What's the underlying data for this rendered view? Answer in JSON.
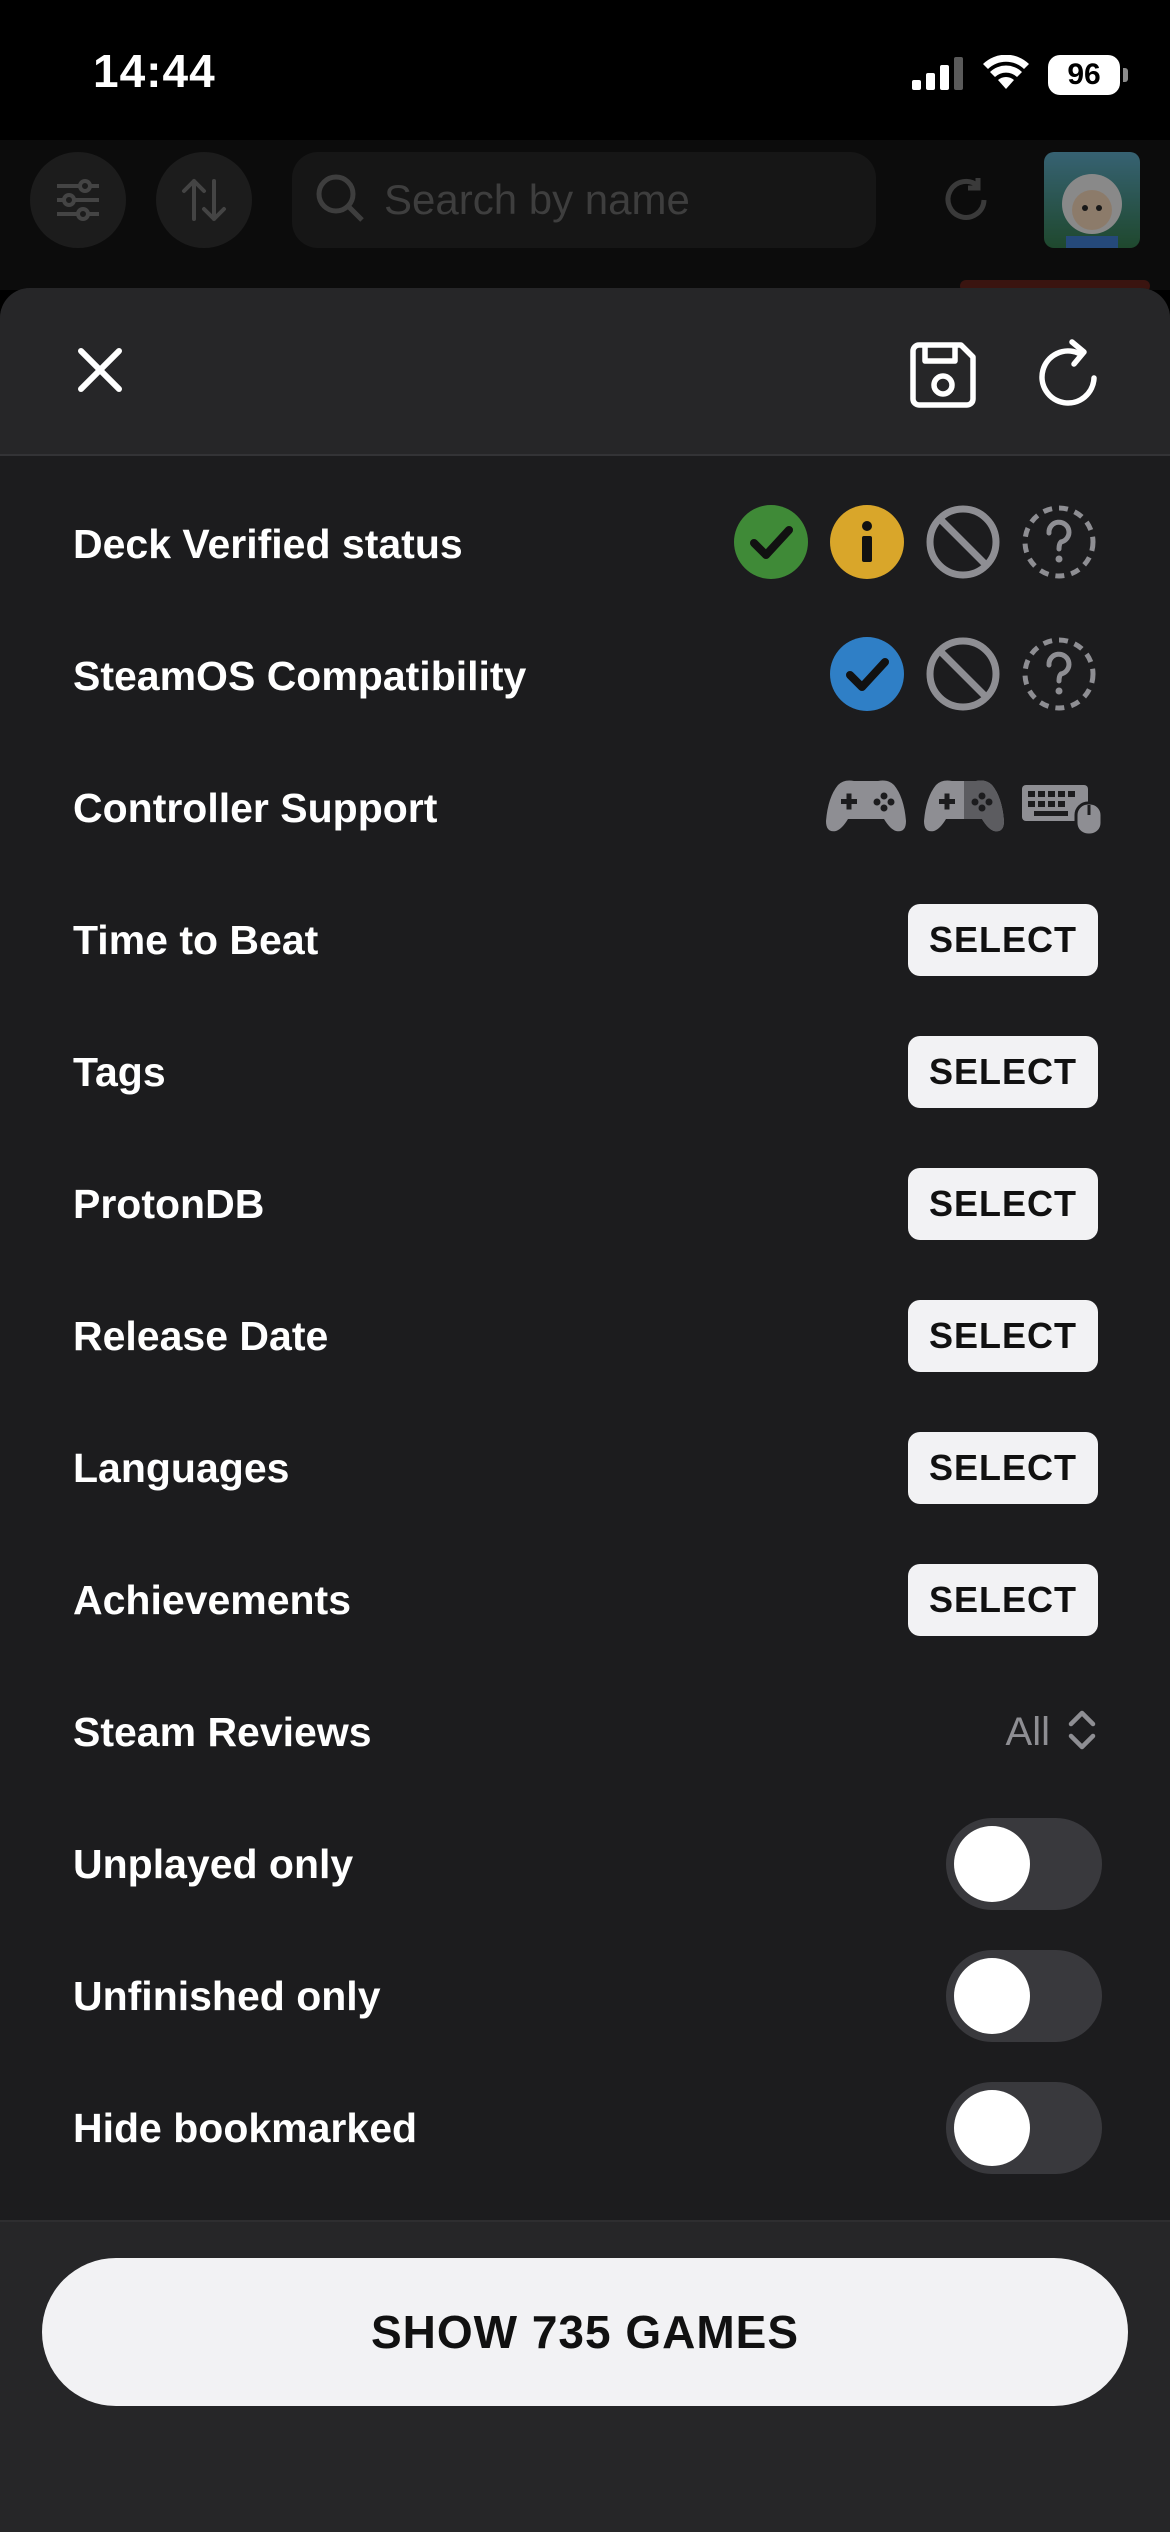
{
  "status_bar": {
    "time": "14:44",
    "battery": "96"
  },
  "background": {
    "search_placeholder": "Search by name"
  },
  "filters": {
    "rows": [
      {
        "label": "Deck Verified status"
      },
      {
        "label": "SteamOS Compatibility"
      },
      {
        "label": "Controller Support"
      },
      {
        "label": "Time to Beat",
        "action": "SELECT"
      },
      {
        "label": "Tags",
        "action": "SELECT"
      },
      {
        "label": "ProtonDB",
        "action": "SELECT"
      },
      {
        "label": "Release Date",
        "action": "SELECT"
      },
      {
        "label": "Languages",
        "action": "SELECT"
      },
      {
        "label": "Achievements",
        "action": "SELECT"
      },
      {
        "label": "Steam Reviews",
        "value": "All"
      },
      {
        "label": "Unplayed only",
        "toggle": false
      },
      {
        "label": "Unfinished only",
        "toggle": false
      },
      {
        "label": "Hide bookmarked",
        "toggle": false
      }
    ]
  },
  "deck_status_icons": [
    {
      "name": "verified",
      "color": "#3f8a37"
    },
    {
      "name": "playable",
      "color": "#d9a62a"
    },
    {
      "name": "unsupported",
      "color": "#8e8e93"
    },
    {
      "name": "unknown",
      "color": "#8e8e93"
    }
  ],
  "steamos_icons": [
    {
      "name": "compatible",
      "color": "#2f7fc6"
    },
    {
      "name": "unsupported",
      "color": "#8e8e93"
    },
    {
      "name": "unknown",
      "color": "#8e8e93"
    }
  ],
  "footer": {
    "show_button": "SHOW 735 GAMES"
  }
}
